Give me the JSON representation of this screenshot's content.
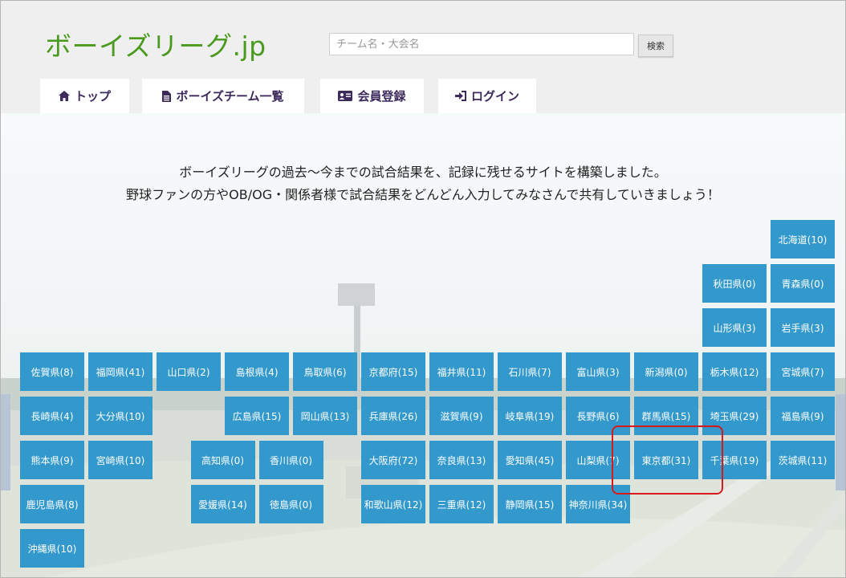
{
  "header": {
    "logo": "ボーイズリーグ.jp",
    "search_placeholder": "チーム名・大会名",
    "search_button": "検索"
  },
  "nav": [
    {
      "label": "トップ",
      "icon": "home-icon"
    },
    {
      "label": "ボーイズチーム一覧",
      "icon": "document-icon"
    },
    {
      "label": "会員登録",
      "icon": "id-card-icon"
    },
    {
      "label": "ログイン",
      "icon": "sign-in-icon"
    }
  ],
  "intro": {
    "line1": "ボーイズリーグの過去〜今までの試合結果を、記録に残せるサイトを構築しました。",
    "line2": "野球ファンの方やOB/OG・関係者様で試合結果をどんどん入力してみなさんで共有していきましょう！"
  },
  "prefectures": [
    {
      "label": "北海道(10)",
      "row": 0,
      "col": 11
    },
    {
      "label": "秋田県(0)",
      "row": 1,
      "col": 10
    },
    {
      "label": "青森県(0)",
      "row": 1,
      "col": 11
    },
    {
      "label": "山形県(3)",
      "row": 2,
      "col": 10
    },
    {
      "label": "岩手県(3)",
      "row": 2,
      "col": 11
    },
    {
      "label": "佐賀県(8)",
      "row": 3,
      "col": 0
    },
    {
      "label": "福岡県(41)",
      "row": 3,
      "col": 1
    },
    {
      "label": "山口県(2)",
      "row": 3,
      "col": 2
    },
    {
      "label": "島根県(4)",
      "row": 3,
      "col": 3
    },
    {
      "label": "鳥取県(6)",
      "row": 3,
      "col": 4
    },
    {
      "label": "京都府(15)",
      "row": 3,
      "col": 5
    },
    {
      "label": "福井県(11)",
      "row": 3,
      "col": 6
    },
    {
      "label": "石川県(7)",
      "row": 3,
      "col": 7
    },
    {
      "label": "富山県(3)",
      "row": 3,
      "col": 8
    },
    {
      "label": "新潟県(0)",
      "row": 3,
      "col": 9
    },
    {
      "label": "栃木県(12)",
      "row": 3,
      "col": 10
    },
    {
      "label": "宮城県(7)",
      "row": 3,
      "col": 11
    },
    {
      "label": "長崎県(4)",
      "row": 4,
      "col": 0
    },
    {
      "label": "大分県(10)",
      "row": 4,
      "col": 1
    },
    {
      "label": "広島県(15)",
      "row": 4,
      "col": 3
    },
    {
      "label": "岡山県(13)",
      "row": 4,
      "col": 4
    },
    {
      "label": "兵庫県(26)",
      "row": 4,
      "col": 5
    },
    {
      "label": "滋賀県(9)",
      "row": 4,
      "col": 6
    },
    {
      "label": "岐阜県(19)",
      "row": 4,
      "col": 7
    },
    {
      "label": "長野県(6)",
      "row": 4,
      "col": 8
    },
    {
      "label": "群馬県(15)",
      "row": 4,
      "col": 9
    },
    {
      "label": "埼玉県(29)",
      "row": 4,
      "col": 10
    },
    {
      "label": "福島県(9)",
      "row": 4,
      "col": 11
    },
    {
      "label": "熊本県(9)",
      "row": 5,
      "col": 0
    },
    {
      "label": "宮崎県(10)",
      "row": 5,
      "col": 1
    },
    {
      "label": "高知県(0)",
      "row": 5,
      "col": 2.5
    },
    {
      "label": "香川県(0)",
      "row": 5,
      "col": 3.5
    },
    {
      "label": "大阪府(72)",
      "row": 5,
      "col": 5
    },
    {
      "label": "奈良県(13)",
      "row": 5,
      "col": 6
    },
    {
      "label": "愛知県(45)",
      "row": 5,
      "col": 7
    },
    {
      "label": "山梨県(7)",
      "row": 5,
      "col": 8
    },
    {
      "label": "東京都(31)",
      "row": 5,
      "col": 9
    },
    {
      "label": "千葉県(19)",
      "row": 5,
      "col": 10
    },
    {
      "label": "茨城県(11)",
      "row": 5,
      "col": 11
    },
    {
      "label": "鹿児島県(8)",
      "row": 6,
      "col": 0
    },
    {
      "label": "愛媛県(14)",
      "row": 6,
      "col": 2.5
    },
    {
      "label": "徳島県(0)",
      "row": 6,
      "col": 3.5
    },
    {
      "label": "和歌山県(12)",
      "row": 6,
      "col": 5
    },
    {
      "label": "三重県(12)",
      "row": 6,
      "col": 6
    },
    {
      "label": "静岡県(15)",
      "row": 6,
      "col": 7
    },
    {
      "label": "神奈川県(34)",
      "row": 6,
      "col": 8
    },
    {
      "label": "沖縄県(10)",
      "row": 7,
      "col": 0
    }
  ],
  "colors": {
    "tile": "#3399cc",
    "logo": "#4a9a1e",
    "nav_text": "#3d2a5c",
    "highlight": "#d7191c"
  }
}
